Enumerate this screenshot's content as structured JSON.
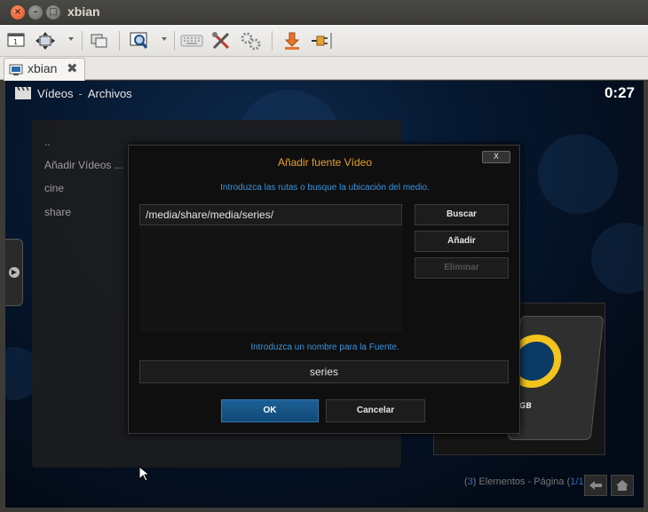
{
  "window": {
    "title": "xbian"
  },
  "toolbar": {
    "icons": [
      "display-icon",
      "fit-screen-icon",
      "chevron-down-icon",
      "windows-icon",
      "zoom-icon",
      "chevron-down-icon",
      "keyboard-icon",
      "tools-icon",
      "settings-icon",
      "download-icon",
      "plug-icon"
    ]
  },
  "tab": {
    "label": "xbian",
    "close": "✖"
  },
  "kodi": {
    "section": "Vídeos",
    "separator": "-",
    "subsection": "Archivos",
    "clock": "0:27",
    "list_items": [
      "..",
      "Añadir Vídeos ...",
      "cine",
      "share"
    ],
    "footer": {
      "count": "3",
      "label": "Elementos - Página",
      "page": "1/1"
    },
    "drive_label": "GB"
  },
  "dialog": {
    "title": "Añadir fuente Vídeo",
    "close_label": "X",
    "prompt_paths": "Introduzca las rutas o busque la ubicación del medio.",
    "path_value": "/media/share/media/series/",
    "buttons": {
      "browse": "Buscar",
      "add": "Añadir",
      "remove": "Eliminar"
    },
    "prompt_name": "Introduzca un nombre para la Fuente.",
    "name_value": "series",
    "ok": "OK",
    "cancel": "Cancelar"
  },
  "colors": {
    "accent_title": "#e8a12a",
    "prompt": "#3b95e0",
    "ok_button": "#1c5f95"
  }
}
